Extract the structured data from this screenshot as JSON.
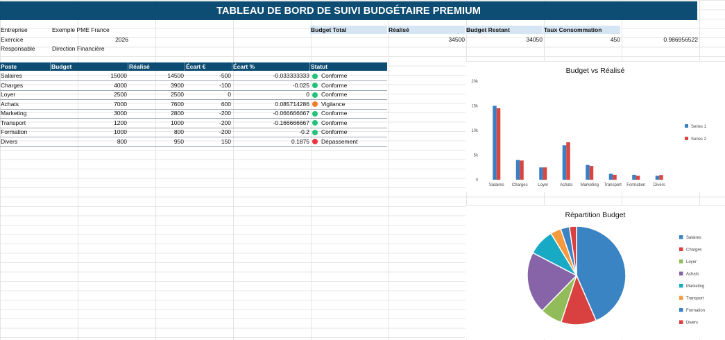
{
  "title": "TABLEAU DE BORD DE SUIVI BUDGÉTAIRE PREMIUM",
  "info": [
    {
      "label": "Entreprise",
      "value": "Exemple PME France"
    },
    {
      "label": "Exercice",
      "value": "2026"
    },
    {
      "label": "Responsable",
      "value": "Direction Financière"
    }
  ],
  "kpi": {
    "headers": [
      "Budget Total",
      "Réalisé",
      "Budget Restant",
      "Taux Consommation"
    ],
    "values": [
      "34500",
      "34050",
      "450",
      "0.986956522"
    ]
  },
  "table": {
    "headers": [
      "Poste",
      "Budget",
      "Réalisé",
      "Écart €",
      "Écart %",
      "Statut"
    ],
    "rows": [
      {
        "poste": "Salaires",
        "budget": "15000",
        "realise": "14500",
        "ecart": "-500",
        "pct": "-0.033333333",
        "statut": "Conforme",
        "status_color": "#22c27a"
      },
      {
        "poste": "Charges",
        "budget": "4000",
        "realise": "3900",
        "ecart": "-100",
        "pct": "-0.025",
        "statut": "Conforme",
        "status_color": "#22c27a"
      },
      {
        "poste": "Loyer",
        "budget": "2500",
        "realise": "2500",
        "ecart": "0",
        "pct": "0",
        "statut": "Conforme",
        "status_color": "#22c27a"
      },
      {
        "poste": "Achats",
        "budget": "7000",
        "realise": "7600",
        "ecart": "600",
        "pct": "0.085714286",
        "statut": "Vigilance",
        "status_color": "#f07d2a"
      },
      {
        "poste": "Marketing",
        "budget": "3000",
        "realise": "2800",
        "ecart": "-200",
        "pct": "-0.066666667",
        "statut": "Conforme",
        "status_color": "#22c27a"
      },
      {
        "poste": "Transport",
        "budget": "1200",
        "realise": "1000",
        "ecart": "-200",
        "pct": "-0.166666667",
        "statut": "Conforme",
        "status_color": "#22c27a"
      },
      {
        "poste": "Formation",
        "budget": "1000",
        "realise": "800",
        "ecart": "-200",
        "pct": "-0.2",
        "statut": "Conforme",
        "status_color": "#22c27a"
      },
      {
        "poste": "Divers",
        "budget": "800",
        "realise": "950",
        "ecart": "150",
        "pct": "0.1875",
        "statut": "Dépassement",
        "status_color": "#e8343d"
      }
    ]
  },
  "chart_data": [
    {
      "type": "bar",
      "title": "Budget vs Réalisé",
      "categories": [
        "Salaires",
        "Charges",
        "Loyer",
        "Achats",
        "Marketing",
        "Transport",
        "Formation",
        "Divers"
      ],
      "series": [
        {
          "name": "Series 1",
          "values": [
            15000,
            4000,
            2500,
            7000,
            3000,
            1200,
            1000,
            800
          ],
          "color": "#3a7fc1"
        },
        {
          "name": "Series 2",
          "values": [
            14500,
            3900,
            2500,
            7600,
            2800,
            1000,
            800,
            950
          ],
          "color": "#d94541"
        }
      ],
      "yticks": [
        "0",
        "5k",
        "10k",
        "15k",
        "20k"
      ],
      "ylim": [
        0,
        20000
      ],
      "legend": "right"
    },
    {
      "type": "pie",
      "title": "Répartition Budget",
      "labels": [
        "Salaires",
        "Charges",
        "Loyer",
        "Achats",
        "Marketing",
        "Transport",
        "Formation",
        "Divers"
      ],
      "values": [
        15000,
        4000,
        2500,
        7000,
        3000,
        1200,
        1000,
        800
      ],
      "colors": [
        "#3a84c4",
        "#d8413f",
        "#92bc5a",
        "#8764a8",
        "#18aac4",
        "#f59a3e",
        "#3a84c4",
        "#d8413f"
      ],
      "legend": "right"
    }
  ]
}
